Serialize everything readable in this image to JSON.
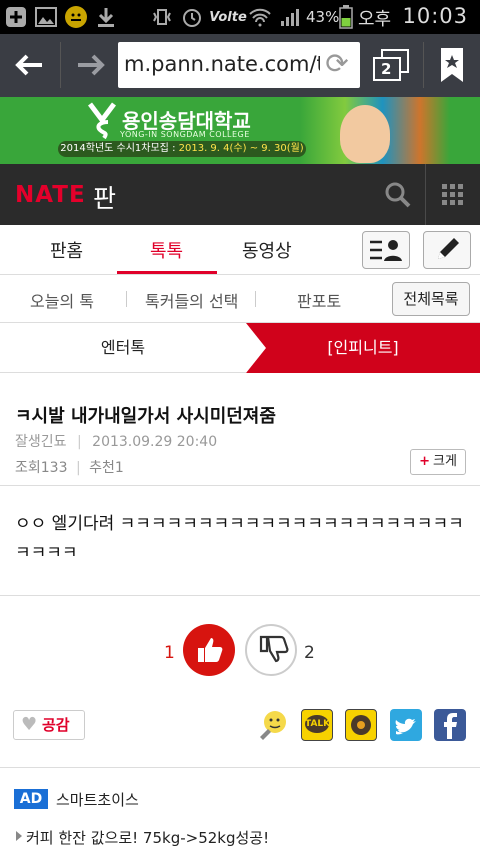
{
  "status_bar": {
    "battery_pct": "43%",
    "ampm": "오후",
    "time": "10:03",
    "network_label": "Volte"
  },
  "browser": {
    "url": "m.pann.nate.com/tal",
    "tab_count": "2"
  },
  "banner": {
    "univ_name": "용인송담대학교",
    "univ_sub": "YONG-IN SONGDAM COLLEGE",
    "notice_prefix": "2014학년도 수시1차모집 : ",
    "notice_dates": "2013. 9. 4(수) ~ 9. 30(월)"
  },
  "header": {
    "brand": "NATE",
    "section": "판"
  },
  "tabs": [
    {
      "label": "판홈",
      "active": false
    },
    {
      "label": "톡톡",
      "active": true
    },
    {
      "label": "동영상",
      "active": false
    }
  ],
  "subnav": {
    "items": [
      "오늘의 톡",
      "톡커들의 선택",
      "판포토"
    ],
    "all_label": "전체목록"
  },
  "category": {
    "left": "엔터톡",
    "right": "[인피니트]"
  },
  "post": {
    "title": "ㅋ시발 내가내일가서 사시미던져줌",
    "author": "잘생긴됴",
    "date": "2013.09.29 20:40",
    "views_label": "조회",
    "views": "133",
    "recommend_label": "추천",
    "recommends": "1",
    "bigger_label": "크게",
    "body": "ㅇㅇ 엘기다려 ㅋㅋㅋㅋㅋㅋㅋㅋㅋㅋㅋㅋㅋㅋㅋㅋㅋㅋㅋㅋㅋㅋㅋㅋㅋㅋ"
  },
  "votes": {
    "up": "1",
    "down": "2"
  },
  "share": {
    "empathy_label": "공감",
    "talk_label": "TALK",
    "icons": [
      "emoticon-icon",
      "kakaotalk-icon",
      "kakaostory-icon",
      "twitter-icon",
      "facebook-icon"
    ]
  },
  "ad": {
    "badge": "AD",
    "name": "스마트초이스",
    "text": "커피 한잔 값으로! 75kg->52kg성공!"
  },
  "colors": {
    "accent_red": "#e0002a",
    "url_bar": "#3a3d44",
    "nate_bar": "#2b2b2b",
    "banner_green": "#39a63a"
  }
}
